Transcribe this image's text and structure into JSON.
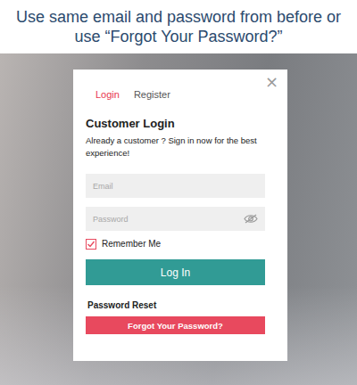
{
  "instruction": {
    "text": "Use same email and password from before or use “Forgot Your Password?”"
  },
  "dialog": {
    "close": "×",
    "tabs": [
      {
        "label": "Login",
        "selected": true
      },
      {
        "label": "Register",
        "selected": false
      }
    ],
    "title": "Customer Login",
    "subtitle": "Already a customer ? Sign in now for the best experience!",
    "fields": [
      {
        "placeholder": "Email",
        "kind": "text"
      },
      {
        "placeholder": "Password",
        "kind": "password"
      }
    ],
    "remember": {
      "label": "Remember Me",
      "checked": true
    },
    "login_button": "Log In",
    "reset": {
      "heading": "Password Reset",
      "button": "Forgot Your Password?"
    }
  }
}
